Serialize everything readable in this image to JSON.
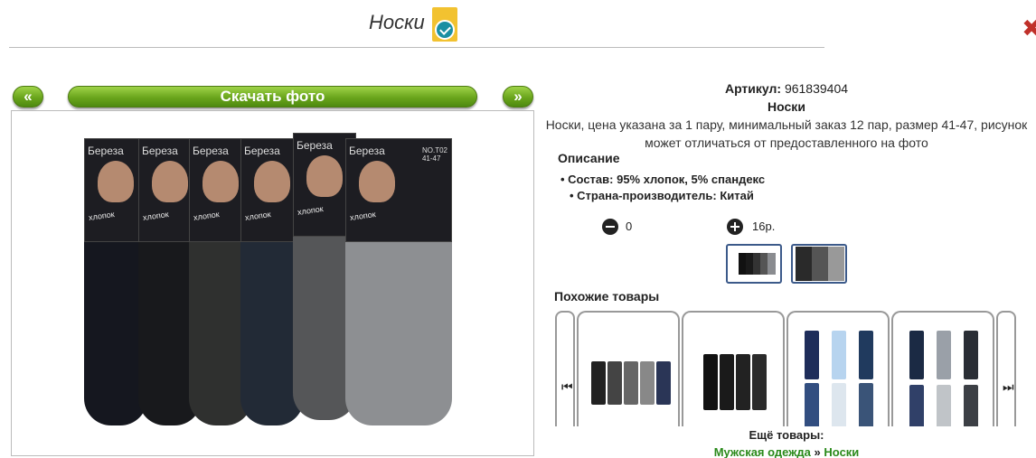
{
  "header": {
    "title": "Носки"
  },
  "nav": {
    "prev_label": "«",
    "download_label": "Скачать фото",
    "next_label": "»"
  },
  "photo": {
    "brand": "Береза",
    "material_logo": "хлопок",
    "model_tag": "NO.T02\n41-47",
    "sock_colors": [
      "#15171f",
      "#18191c",
      "#2f302f",
      "#222a36",
      "#555658",
      "#8d8f92"
    ]
  },
  "product": {
    "article_label": "Артикул:",
    "article_value": "961839404",
    "name": "Носки",
    "description": "Носки, цена указана за 1 пару, минимальный заказ 12 пар, размер 41-47, рисунок может отличаться от предоставленного на фото",
    "section_title": "Описание",
    "specs": [
      "Состав: 95% хлопок, 5% спандекс",
      "Страна-производитель: Китай"
    ],
    "quantity": "0",
    "price": "16р."
  },
  "similar": {
    "title": "Похожие товары"
  },
  "footer": {
    "more_label": "Ещё товары:",
    "crumb_1": "Мужская одежда",
    "separator": "»",
    "crumb_2": "Носки"
  },
  "colors": {
    "accent_green": "#6aa51c",
    "link_green": "#2a8a1a",
    "thumb_border": "#3c5a8a",
    "close_red": "#c0302a"
  }
}
